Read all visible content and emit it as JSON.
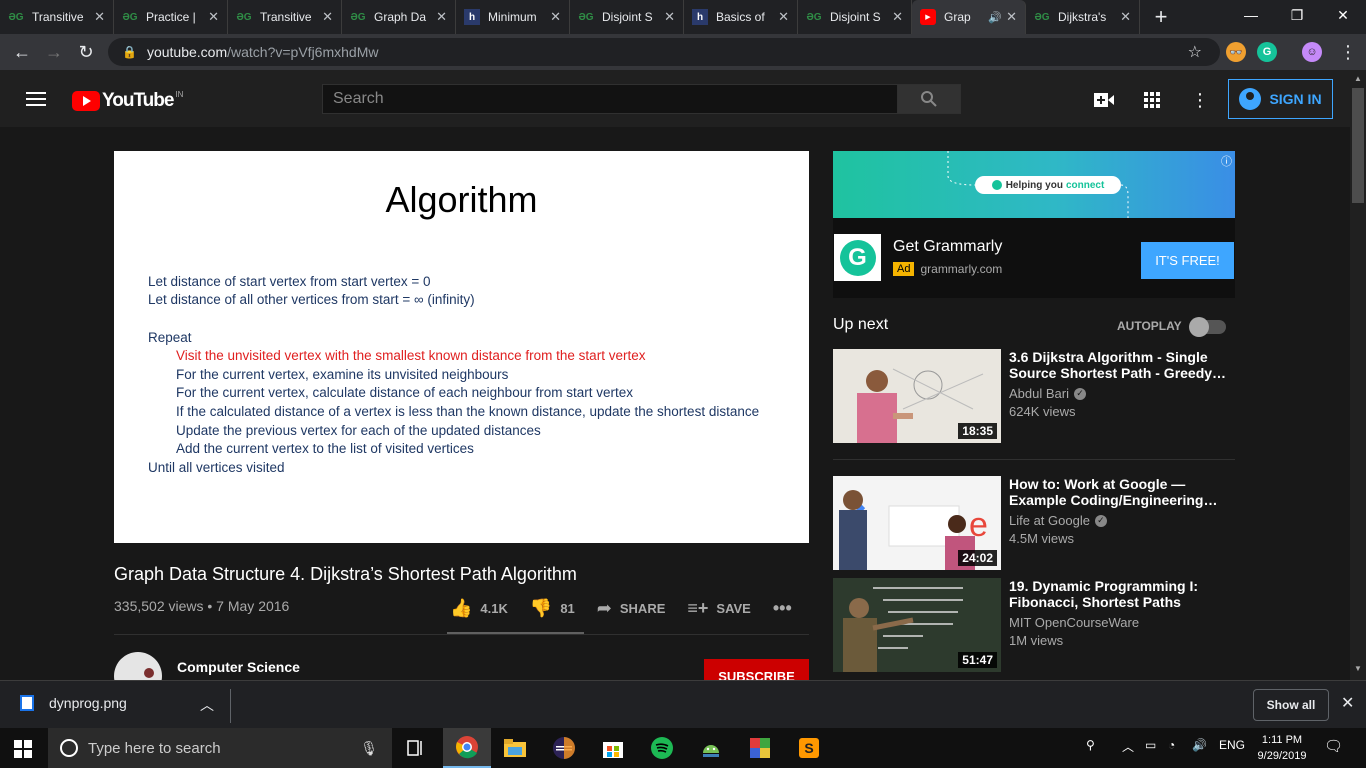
{
  "browser": {
    "tabs": [
      {
        "label": "Transitive",
        "favicon": "gfg"
      },
      {
        "label": "Practice |",
        "favicon": "gfg"
      },
      {
        "label": "Transitive",
        "favicon": "gfg"
      },
      {
        "label": "Graph Da",
        "favicon": "gfg"
      },
      {
        "label": "Minimum",
        "favicon": "h"
      },
      {
        "label": "Disjoint S",
        "favicon": "gfg"
      },
      {
        "label": "Basics of",
        "favicon": "h"
      },
      {
        "label": "Disjoint S",
        "favicon": "gfg"
      },
      {
        "label": "Grap",
        "favicon": "youtube",
        "active": true
      },
      {
        "label": "Dijkstra's",
        "favicon": "gfg"
      }
    ],
    "url_domain": "youtube.com",
    "url_path": "/watch?v=pVfj6mxhdMw"
  },
  "masthead": {
    "logo_text": "YouTube",
    "country_code": "IN",
    "search_placeholder": "Search",
    "signin_label": "SIGN IN"
  },
  "slide": {
    "title": "Algorithm",
    "lines": [
      "Let distance of start vertex from start vertex = 0",
      "Let distance of all other vertices from start = ∞ (infinity)",
      "Repeat",
      "Visit the unvisited vertex with the smallest known distance from the start vertex",
      "For the current vertex, examine its unvisited neighbours",
      "For the current vertex, calculate distance of each neighbour from start vertex",
      "If the calculated distance of a vertex is less than the known distance, update the shortest distance",
      "Update the previous vertex for each of the updated distances",
      "Add the current vertex to the list of visited vertices",
      "Until all vertices visited"
    ]
  },
  "video": {
    "title": "Graph Data Structure 4. Dijkstra’s Shortest Path Algorithm",
    "meta": "335,502 views • 7 May 2016",
    "likes": "4.1K",
    "dislikes": "81",
    "share_label": "SHARE",
    "save_label": "SAVE",
    "channel": "Computer Science",
    "subscribe_label": "SUBSCRIBE"
  },
  "ad": {
    "banner_text_prefix": "Helping you",
    "banner_text_accent": "connect",
    "title": "Get Grammarly",
    "tag": "Ad",
    "domain": "grammarly.com",
    "cta": "IT'S FREE!"
  },
  "sidebar": {
    "upnext_label": "Up next",
    "autoplay_label": "AUTOPLAY",
    "videos": [
      {
        "title": "3.6 Dijkstra Algorithm - Single Source Shortest Path - Greedy…",
        "channel": "Abdul Bari",
        "views": "624K views",
        "duration": "18:35"
      },
      {
        "title": "How to: Work at Google — Example Coding/Engineering…",
        "channel": "Life at Google",
        "views": "4.5M views",
        "duration": "24:02"
      },
      {
        "title": "19. Dynamic Programming I: Fibonacci, Shortest Paths",
        "channel": "MIT OpenCourseWare",
        "views": "1M views",
        "duration": "51:47"
      }
    ]
  },
  "downloads": {
    "file": "dynprog.png",
    "show_all": "Show all"
  },
  "taskbar": {
    "search_placeholder": "Type here to search",
    "language": "ENG",
    "time": "1:11 PM",
    "date": "9/29/2019"
  }
}
